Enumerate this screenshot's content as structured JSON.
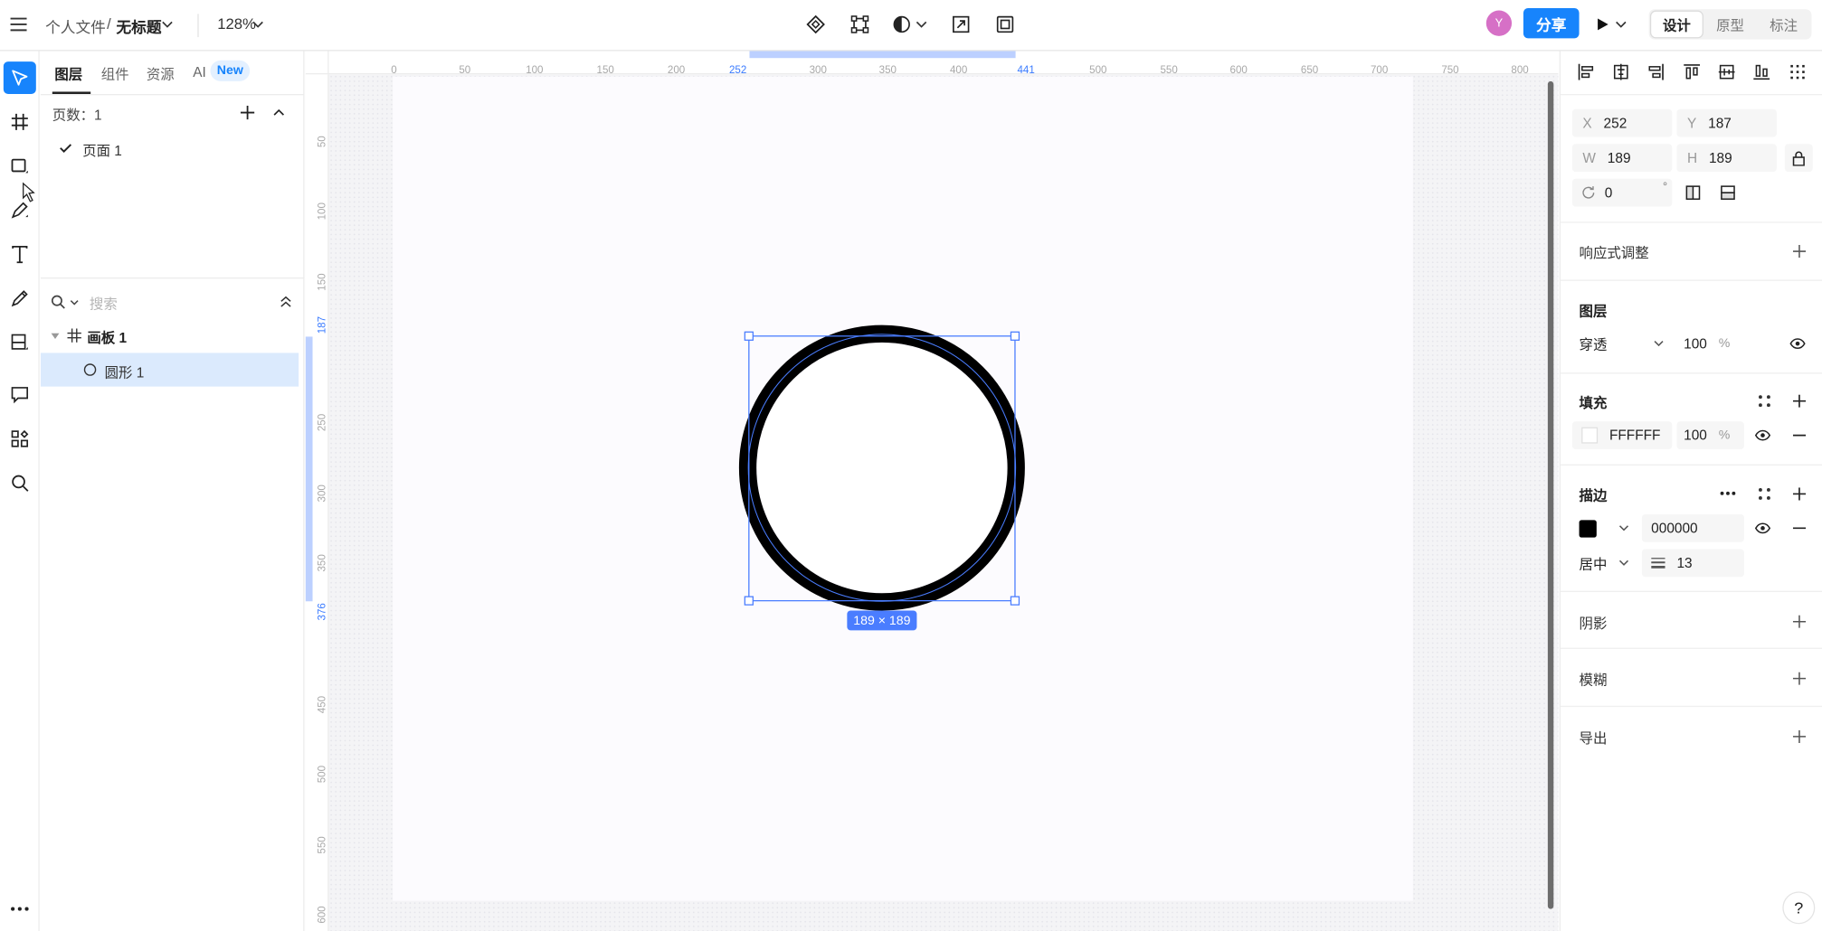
{
  "topbar": {
    "breadcrumb_parent": "个人文件",
    "breadcrumb_sep": "/",
    "file_name": "无标题",
    "zoom": "128%",
    "avatar_initial": "Y",
    "share_label": "分享",
    "modes": [
      "设计",
      "原型",
      "标注"
    ],
    "active_mode": "设计"
  },
  "layers_panel": {
    "tabs": [
      "图层",
      "组件",
      "资源",
      "AI"
    ],
    "new_badge": "New",
    "pages_label": "页数：1",
    "pages": [
      {
        "label": "页面 1",
        "checked": true
      }
    ],
    "search_placeholder": "搜索",
    "tree": [
      {
        "label": "画板 1",
        "type": "frame",
        "expanded": true
      },
      {
        "label": "圆形 1",
        "type": "ellipse",
        "selected": true
      }
    ]
  },
  "canvas": {
    "h_ticks": [
      "50",
      "100",
      "150",
      "200",
      "300",
      "350",
      "400",
      "500",
      "550",
      "600",
      "650",
      "700",
      "750",
      "800"
    ],
    "h_sel": [
      "252",
      "441"
    ],
    "v_ticks": [
      "50",
      "100",
      "150",
      "250",
      "300",
      "350",
      "450",
      "500",
      "550",
      "600"
    ],
    "v_sel": [
      "187",
      "376"
    ],
    "size_badge": "189 × 189",
    "h_zero": "0"
  },
  "properties": {
    "x_label": "X",
    "x": "252",
    "y_label": "Y",
    "y": "187",
    "w_label": "W",
    "w": "189",
    "h_label": "H",
    "h": "189",
    "rotation": "0",
    "degree": "°",
    "responsive_label": "响应式调整",
    "layer_label": "图层",
    "blend_mode": "穿透",
    "layer_opacity": "100",
    "percent": "%",
    "fill_label": "填充",
    "fill_hex": "FFFFFF",
    "fill_opacity": "100",
    "stroke_label": "描边",
    "stroke_hex": "000000",
    "stroke_align": "居中",
    "stroke_width": "13",
    "shadow_label": "阴影",
    "blur_label": "模糊",
    "export_label": "导出"
  },
  "colors": {
    "accent": "#1784fc",
    "selection": "#4a7dff",
    "stroke": "#000000",
    "fill": "#ffffff"
  }
}
